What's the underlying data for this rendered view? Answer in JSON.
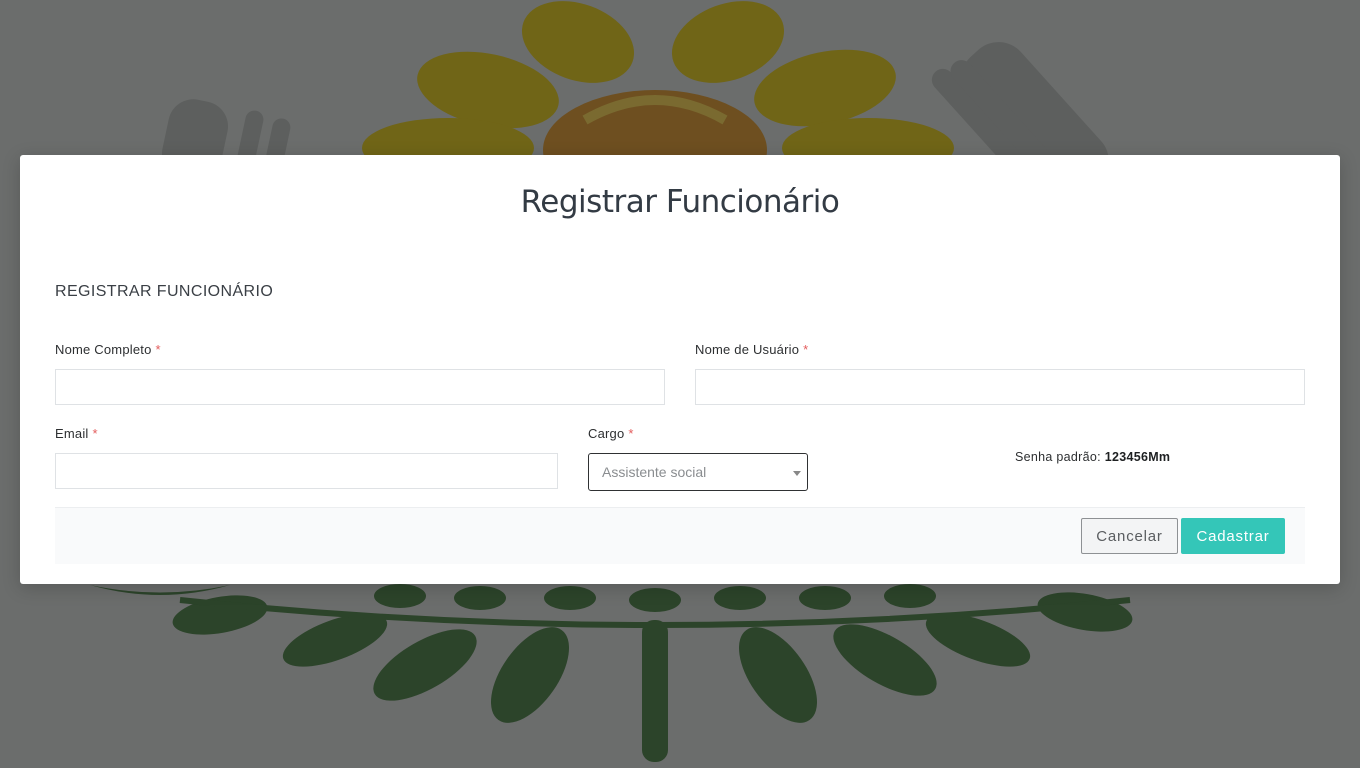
{
  "modal": {
    "title": "Registrar Funcionário",
    "section_title": "REGISTRAR FUNCIONÁRIO"
  },
  "form": {
    "full_name": {
      "label": "Nome Completo",
      "required_mark": "*",
      "value": ""
    },
    "username": {
      "label": "Nome de Usuário",
      "required_mark": "*",
      "value": ""
    },
    "email": {
      "label": "Email",
      "required_mark": "*",
      "value": ""
    },
    "role": {
      "label": "Cargo",
      "required_mark": "*",
      "selected": "Assistente social"
    },
    "default_password": {
      "label": "Senha padrão:",
      "value": "123456Mm"
    }
  },
  "footer": {
    "cancel_label": "Cancelar",
    "submit_label": "Cadastrar"
  },
  "colors": {
    "accent": "#34c6b8",
    "required": "#e35b5b",
    "overlay": "#6b6d6c"
  }
}
